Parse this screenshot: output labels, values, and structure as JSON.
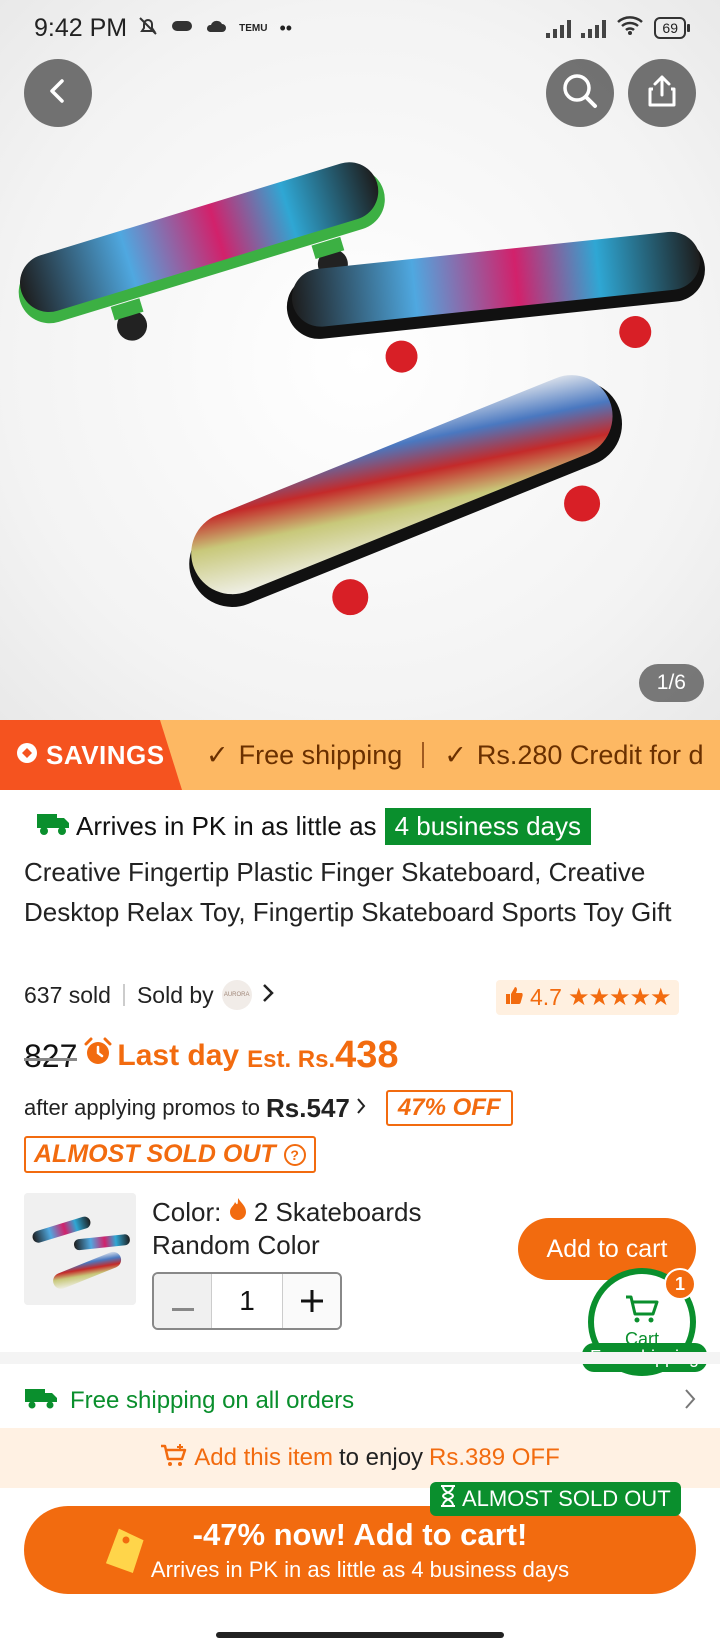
{
  "status_bar": {
    "time": "9:42 PM",
    "battery": "69",
    "temu_label": "TEMU"
  },
  "hero": {
    "image_counter": "1/6"
  },
  "savings_bar": {
    "tag": "SAVINGS",
    "items": [
      "Free shipping",
      "Rs.280 Credit for d"
    ]
  },
  "delivery": {
    "prefix": "Arrives in PK in as little as",
    "badge": "4 business days"
  },
  "product": {
    "title": "Creative Fingertip Plastic Finger Skateboard, Creative Desktop Relax Toy, Fingertip Skateboard Sports Toy Gift",
    "sold": "637 sold",
    "sold_by": "Sold by",
    "seller_logo_text": "AURORA",
    "rating": "4.7",
    "star_rating": 4.7
  },
  "pricing": {
    "original": "827",
    "last_day": "Last day",
    "est_label": "Est. Rs.",
    "est_value": "438",
    "promo_text": "after applying promos to",
    "promo_value": "Rs.547",
    "off_badge": "47% OFF",
    "almost_sold_out": "ALMOST SOLD OUT"
  },
  "variant": {
    "color_label": "Color:",
    "color_value": "2 Skateboards Random Color",
    "quantity": "1"
  },
  "cart": {
    "add_to_cart": "Add to cart",
    "cart_label": "Cart",
    "count": "1",
    "free_shipping": "Free shipping"
  },
  "shipping_row": {
    "text": "Free shipping on all orders"
  },
  "add_row": {
    "link": "Add this item",
    "middle": "to enjoy",
    "discount": "Rs.389 OFF"
  },
  "cta": {
    "almost_label": "ALMOST SOLD OUT",
    "main": "-47% now! Add to cart!",
    "sub": "Arrives in PK in as little as 4 business days"
  },
  "colors": {
    "accent": "#f26b0f",
    "green": "#0a8f2d",
    "savings_bg": "#fdb863",
    "savings_tag": "#f5531f"
  }
}
